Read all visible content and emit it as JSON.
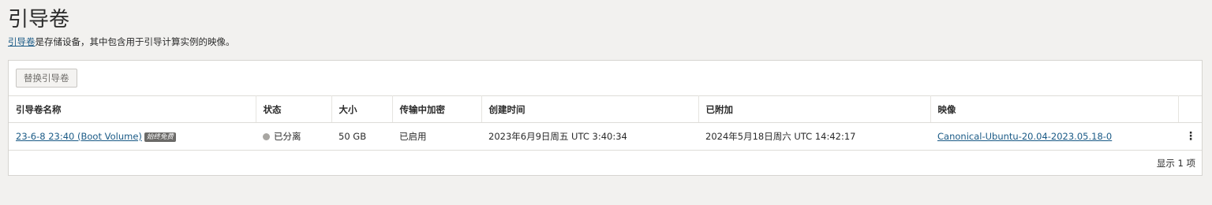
{
  "page": {
    "title": "引导卷",
    "subtitle_link": "引导卷",
    "subtitle_text": "是存储设备，其中包含用于引导计算实例的映像。"
  },
  "toolbar": {
    "replace_button": "替换引导卷"
  },
  "table": {
    "headers": {
      "name": "引导卷名称",
      "status": "状态",
      "size": "大小",
      "encryption": "传输中加密",
      "created": "创建时间",
      "attached": "已附加",
      "image": "映像"
    },
    "rows": [
      {
        "name": "23-6-8 23:40 (Boot Volume)",
        "tag": "始终免费",
        "status": "已分离",
        "size": "50 GB",
        "encryption": "已启用",
        "created": "2023年6月9日周五 UTC 3:40:34",
        "attached": "2024年5月18日周六 UTC 14:42:17",
        "image": "Canonical-Ubuntu-20.04-2023.05.18-0",
        "actions": "⋮"
      }
    ]
  },
  "footer": {
    "count": "显示 1 项"
  },
  "colors": {
    "link": "#1a5a86",
    "status_detached": "#a8a6a2",
    "tag_bg": "#6b6a68"
  }
}
